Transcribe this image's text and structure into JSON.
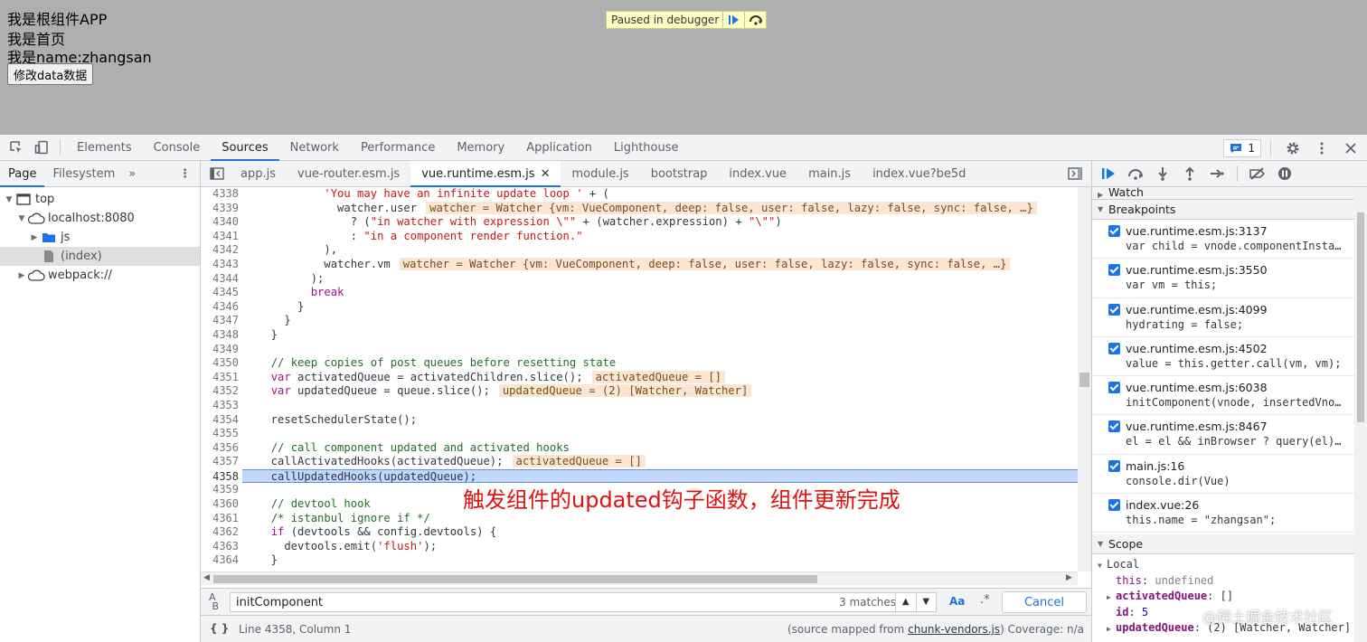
{
  "viewport": {
    "lines": [
      "我是根组件APP",
      "我是首页",
      "我是name:zhangsan"
    ],
    "button_label": "修改data数据",
    "paused_text": "Paused in debugger"
  },
  "devtools": {
    "tabs": [
      "Elements",
      "Console",
      "Sources",
      "Network",
      "Performance",
      "Memory",
      "Application",
      "Lighthouse"
    ],
    "active_tab": "Sources",
    "issues_count": "1"
  },
  "navigator": {
    "tabs": [
      "Page",
      "Filesystem"
    ],
    "more": "»",
    "tree": [
      {
        "label": "top",
        "indent": 0,
        "icon": "frame",
        "open": true
      },
      {
        "label": "localhost:8080",
        "indent": 1,
        "icon": "cloud",
        "open": true
      },
      {
        "label": "js",
        "indent": 2,
        "icon": "folder",
        "open": false
      },
      {
        "label": "(index)",
        "indent": 2,
        "icon": "file",
        "open": null,
        "selected": true
      },
      {
        "label": "webpack://",
        "indent": 1,
        "icon": "cloud",
        "open": false
      }
    ]
  },
  "editor": {
    "file_tabs": [
      "app.js",
      "vue-router.esm.js",
      "vue.runtime.esm.js",
      "module.js",
      "bootstrap",
      "index.vue",
      "main.js",
      "index.vue?be5d"
    ],
    "active_file": "vue.runtime.esm.js",
    "lines": [
      {
        "n": "4338",
        "code": [
          [
            "",
            "          "
          ],
          [
            "str",
            "'You may have an infinite update loop '"
          ],
          [
            "",
            " + ("
          ]
        ]
      },
      {
        "n": "4339",
        "code": [
          [
            "",
            "            watcher.user"
          ]
        ],
        "inline": "watcher = Watcher {vm: VueComponent, deep: false, user: false, lazy: false, sync: false, …}"
      },
      {
        "n": "4340",
        "code": [
          [
            "",
            "              ? ("
          ],
          [
            "str",
            "\"in watcher with expression \\\"\""
          ],
          [
            "",
            " + (watcher.expression) + "
          ],
          [
            "str",
            "\"\\\"\""
          ],
          [
            "",
            ")"
          ]
        ]
      },
      {
        "n": "4341",
        "code": [
          [
            "",
            "              : "
          ],
          [
            "str",
            "\"in a component render function.\""
          ]
        ]
      },
      {
        "n": "4342",
        "code": [
          [
            "",
            "          ),"
          ]
        ]
      },
      {
        "n": "4343",
        "code": [
          [
            "",
            "          watcher.vm"
          ]
        ],
        "inline": "watcher = Watcher {vm: VueComponent, deep: false, user: false, lazy: false, sync: false, …}"
      },
      {
        "n": "4344",
        "code": [
          [
            "",
            "        );"
          ]
        ]
      },
      {
        "n": "4345",
        "code": [
          [
            "",
            "        "
          ],
          [
            "kw",
            "break"
          ]
        ]
      },
      {
        "n": "4346",
        "code": [
          [
            "",
            "      }"
          ]
        ]
      },
      {
        "n": "4347",
        "code": [
          [
            "",
            "    }"
          ]
        ]
      },
      {
        "n": "4348",
        "code": [
          [
            "",
            "  }"
          ]
        ]
      },
      {
        "n": "4349",
        "code": [
          [
            "",
            ""
          ]
        ]
      },
      {
        "n": "4350",
        "code": [
          [
            "",
            "  "
          ],
          [
            "cm",
            "// keep copies of post queues before resetting state"
          ]
        ]
      },
      {
        "n": "4351",
        "code": [
          [
            "",
            "  "
          ],
          [
            "kw",
            "var"
          ],
          [
            "",
            " activatedQueue = activatedChildren.slice();"
          ]
        ],
        "inline": "activatedQueue = []"
      },
      {
        "n": "4352",
        "code": [
          [
            "",
            "  "
          ],
          [
            "kw",
            "var"
          ],
          [
            "",
            " updatedQueue = queue.slice();"
          ]
        ],
        "inline": "updatedQueue = (2) [Watcher, Watcher]"
      },
      {
        "n": "4353",
        "code": [
          [
            "",
            ""
          ]
        ]
      },
      {
        "n": "4354",
        "code": [
          [
            "",
            "  resetSchedulerState();"
          ]
        ]
      },
      {
        "n": "4355",
        "code": [
          [
            "",
            ""
          ]
        ]
      },
      {
        "n": "4356",
        "code": [
          [
            "",
            "  "
          ],
          [
            "cm",
            "// call component updated and activated hooks"
          ]
        ]
      },
      {
        "n": "4357",
        "code": [
          [
            "",
            "  callActivatedHooks(activatedQueue);"
          ]
        ],
        "inline": "activatedQueue = []"
      },
      {
        "n": "4358",
        "code": [
          [
            "",
            "  callUpdatedHooks(updatedQueue);"
          ]
        ],
        "highlight": true
      },
      {
        "n": "4359",
        "code": [
          [
            "",
            ""
          ]
        ]
      },
      {
        "n": "4360",
        "code": [
          [
            "",
            "  "
          ],
          [
            "cm",
            "// devtool hook"
          ]
        ]
      },
      {
        "n": "4361",
        "code": [
          [
            "",
            "  "
          ],
          [
            "cm",
            "/* istanbul ignore if */"
          ]
        ]
      },
      {
        "n": "4362",
        "code": [
          [
            "",
            "  "
          ],
          [
            "kw",
            "if"
          ],
          [
            "",
            " (devtools && config.devtools) {"
          ]
        ]
      },
      {
        "n": "4363",
        "code": [
          [
            "",
            "    devtools.emit("
          ],
          [
            "str",
            "'flush'"
          ],
          [
            "",
            ");"
          ]
        ]
      },
      {
        "n": "4364",
        "code": [
          [
            "",
            "  }"
          ]
        ]
      }
    ],
    "annotation": "触发组件的updated钩子函数，组件更新完成",
    "search": {
      "value": "initComponent",
      "matches": "3 matches",
      "aa": "Aa",
      "regex": ".*",
      "cancel": "Cancel"
    },
    "status": {
      "position": "Line 4358, Column 1",
      "source_prefix": "(source mapped from ",
      "source_link": "chunk-vendors.js",
      "source_suffix": ")  Coverage: n/a"
    }
  },
  "debugger": {
    "watch_label": "Watch",
    "breakpoints_label": "Breakpoints",
    "breakpoints": [
      {
        "loc": "vue.runtime.esm.js:3137",
        "code": "var child = vnode.componentInstance…"
      },
      {
        "loc": "vue.runtime.esm.js:3550",
        "code": "var vm = this;"
      },
      {
        "loc": "vue.runtime.esm.js:4099",
        "code": "hydrating = false;"
      },
      {
        "loc": "vue.runtime.esm.js:4502",
        "code": "value = this.getter.call(vm, vm);"
      },
      {
        "loc": "vue.runtime.esm.js:6038",
        "code": "initComponent(vnode, insertedVno…"
      },
      {
        "loc": "vue.runtime.esm.js:8467",
        "code": "el = el && inBrowser ? query(el)…"
      },
      {
        "loc": "main.js:16",
        "code": "console.dir(Vue)"
      },
      {
        "loc": "index.vue:26",
        "code": "this.name = \"zhangsan\";"
      }
    ],
    "scope_label": "Scope",
    "local_label": "Local",
    "scope_rows": [
      {
        "key": "this",
        "sep": ": ",
        "value": "undefined",
        "expandable": false,
        "bold": false
      },
      {
        "key": "activatedQueue",
        "sep": ": ",
        "value": "[]",
        "expandable": true,
        "bold": true
      },
      {
        "key": "id",
        "sep": ": ",
        "value": "5",
        "expandable": false,
        "bold": true,
        "num": true
      },
      {
        "key": "updatedQueue",
        "sep": ": ",
        "value": "(2) [Watcher, Watcher]",
        "expandable": true,
        "bold": true
      }
    ]
  },
  "watermark": "@稀土掘金技术社区",
  "colors": {
    "accent": "#1a73e8",
    "highlight_line": "#c2d7fc",
    "inline_value_bg": "#fbe6d4",
    "annotation": "#e0110f"
  }
}
